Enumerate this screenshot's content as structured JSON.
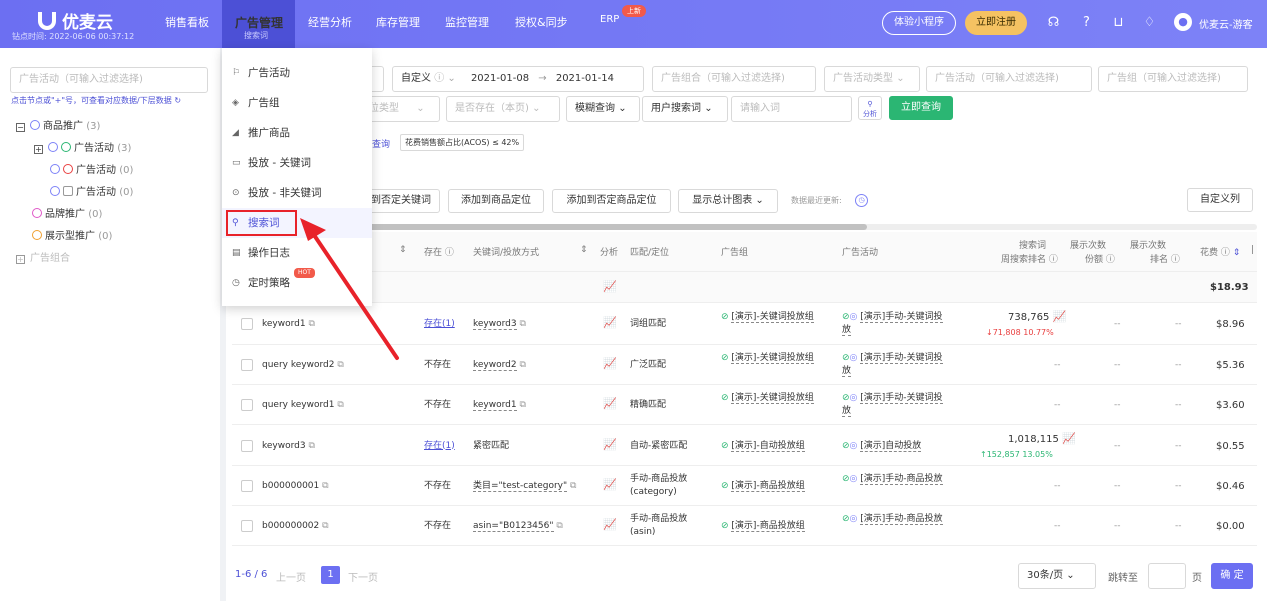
{
  "app": {
    "name": "优麦云",
    "session_time": "钻点时间: 2022-06-06 00:37:12"
  },
  "nav": {
    "items": [
      "销售看板",
      "广告管理",
      "经营分析",
      "库存管理",
      "监控管理",
      "授权&同步",
      "ERP"
    ],
    "active_sub": "搜索词",
    "erp_badge": "上新",
    "try_btn": "体验小程序",
    "register_btn": "立即注册",
    "user": "优麦云-游客"
  },
  "sidebar": {
    "filter_placeholder": "广告活动（可输入过滤选择)",
    "hint": "点击节点或\"+\"号，可查看对应数据/下层数据",
    "tree": [
      {
        "label": "商品推广",
        "count": "(3)"
      },
      {
        "label": "广告活动",
        "count": "(3)"
      },
      {
        "label": "广告活动",
        "count": "(0)"
      },
      {
        "label": "广告活动",
        "count": "(0)"
      },
      {
        "label": "品牌推广",
        "count": "(0)"
      },
      {
        "label": "展示型推广",
        "count": "(0)"
      },
      {
        "label": "广告组合",
        "count": ""
      }
    ]
  },
  "filters": {
    "date_mode": "自定义",
    "date_start": "2021-01-08",
    "date_arrow": "→",
    "date_end": "2021-01-14",
    "adgroup_combo": "广告组合（可输入过滤选择)",
    "campaign_type": "广告活动类型",
    "campaign": "广告活动（可输入过滤选择)",
    "adgroup": "广告组（可输入过滤选择)",
    "targeting_type": "位类型",
    "exists": "是否存在（本页)",
    "match": "模糊查询",
    "search_field": "用户搜索词",
    "search_placeholder": "请输入词",
    "analyze": "分析",
    "query_btn": "立即查询",
    "tag_query": "查询",
    "acos_tag": "花费销售额占比(ACOS) ≤ 42%"
  },
  "toolbar": {
    "buttons": [
      "加到否定关键词",
      "添加到商品定位",
      "添加到否定商品定位",
      "显示总计图表"
    ],
    "update_label": "数据最近更新:",
    "custom_cols": "自定义列"
  },
  "table": {
    "headers": {
      "exists": "存在",
      "keyword": "关键词/投放方式",
      "analysis": "分析",
      "match": "匹配/定位",
      "adgroup": "广告组",
      "campaign": "广告活动",
      "rank1": "搜索词",
      "rank2": "周搜索排名",
      "imp1": "展示次数",
      "imp2": "份额",
      "imp3": "展示次数",
      "imp4": "排名",
      "spend": "花费"
    },
    "total_spend": "$18.93",
    "rows": [
      {
        "term": "keyword1",
        "exists": "存在(1)",
        "kw": "keyword3",
        "match": "词组匹配",
        "adgroup": "[演示]-关键词投放组",
        "campaign": "[演示]手动-关键词投放",
        "rank": "738,765",
        "delta": "↓71,808  10.77%",
        "imp": "--",
        "imp_rank": "--",
        "spend": "$8.96"
      },
      {
        "term": "query keyword2",
        "exists": "不存在",
        "kw": "keyword2",
        "match": "广泛匹配",
        "adgroup": "[演示]-关键词投放组",
        "campaign": "[演示]手动-关键词投放",
        "rank": "--",
        "delta": "",
        "imp": "--",
        "imp_rank": "--",
        "spend": "$5.36"
      },
      {
        "term": "query keyword1",
        "exists": "不存在",
        "kw": "keyword1",
        "match": "精确匹配",
        "adgroup": "[演示]-关键词投放组",
        "campaign": "[演示]手动-关键词投放",
        "rank": "--",
        "delta": "",
        "imp": "--",
        "imp_rank": "--",
        "spend": "$3.60"
      },
      {
        "term": "keyword3",
        "exists": "存在(1)",
        "kw": "紧密匹配",
        "match": "自动-紧密匹配",
        "adgroup": "[演示]-自动投放组",
        "campaign": "[演示]自动投放",
        "rank": "1,018,115",
        "delta": "↑152,857  13.05%",
        "imp": "--",
        "imp_rank": "--",
        "spend": "$0.55"
      },
      {
        "term": "b000000001",
        "exists": "不存在",
        "kw": "类目=\"test-category\"",
        "match": "手动-商品投放 (category)",
        "adgroup": "[演示]-商品投放组",
        "campaign": "[演示]手动-商品投放",
        "rank": "--",
        "delta": "",
        "imp": "--",
        "imp_rank": "--",
        "spend": "$0.46"
      },
      {
        "term": "b000000002",
        "exists": "不存在",
        "kw": "asin=\"B0123456\"",
        "match": "手动-商品投放 (asin)",
        "adgroup": "[演示]-商品投放组",
        "campaign": "[演示]手动-商品投放",
        "rank": "--",
        "delta": "",
        "imp": "--",
        "imp_rank": "--",
        "spend": "$0.00"
      }
    ]
  },
  "pager": {
    "range": "1-6 / 6",
    "prev": "上一页",
    "page": "1",
    "next": "下一页",
    "page_size": "30条/页",
    "goto": "跳转至",
    "page_unit": "页",
    "confirm": "确 定"
  },
  "dropdown": {
    "items": [
      "广告活动",
      "广告组",
      "推广商品",
      "投放 - 关键词",
      "投放 - 非关键词",
      "搜索词",
      "操作日志",
      "定时策略"
    ],
    "hot": "HOT"
  }
}
